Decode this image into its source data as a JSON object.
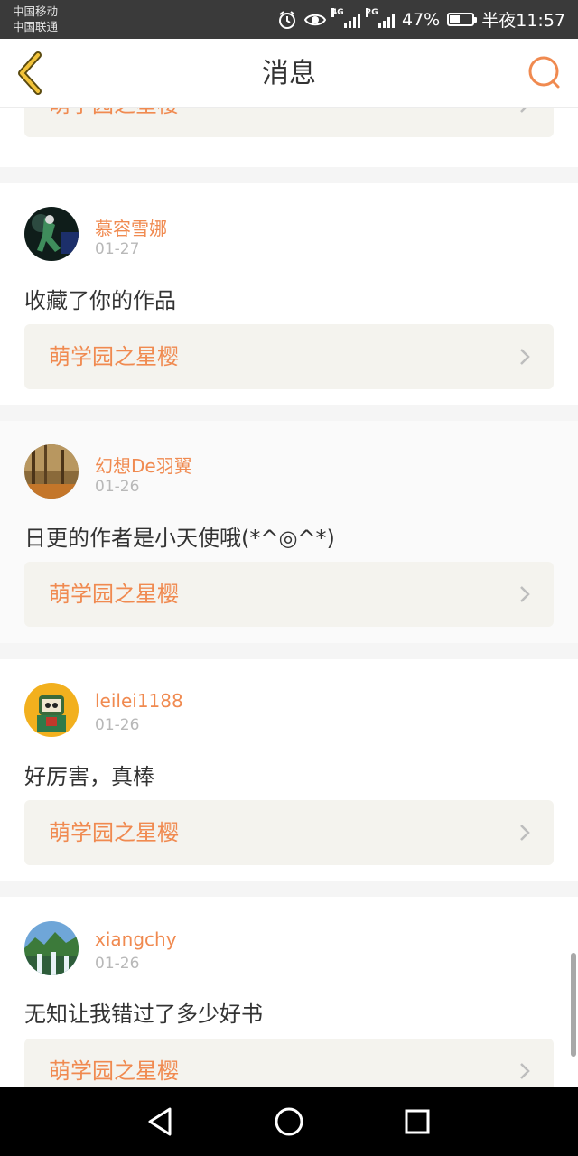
{
  "status_bar": {
    "carrier1": "中国移动",
    "carrier2": "中国联通",
    "net1": "4G",
    "net2": "2G",
    "battery_text": "47%",
    "battery_level": 0.47,
    "time": "半夜11:57",
    "icons": [
      "alarm-icon",
      "eye-icon",
      "signal-icon",
      "battery-icon"
    ]
  },
  "header": {
    "title": "消息",
    "accent": "#f08a50"
  },
  "messages": [
    {
      "user": "",
      "date": "",
      "text": "",
      "link": "萌学园之星樱"
    },
    {
      "user": "慕容雪娜",
      "date": "01-27",
      "text": "收藏了你的作品",
      "link": "萌学园之星樱"
    },
    {
      "user": "幻想De羽翼",
      "date": "01-26",
      "text": "日更的作者是小天使哦(*^◎^*)",
      "link": "萌学园之星樱"
    },
    {
      "user": "leilei1188",
      "date": "01-26",
      "text": "好厉害，真棒",
      "link": "萌学园之星樱"
    },
    {
      "user": "xiangchy",
      "date": "01-26",
      "text": "无知让我错过了多少好书",
      "link": "萌学园之星樱"
    }
  ],
  "nav": {
    "icons": [
      "back-triangle-icon",
      "home-circle-icon",
      "recents-square-icon"
    ]
  }
}
